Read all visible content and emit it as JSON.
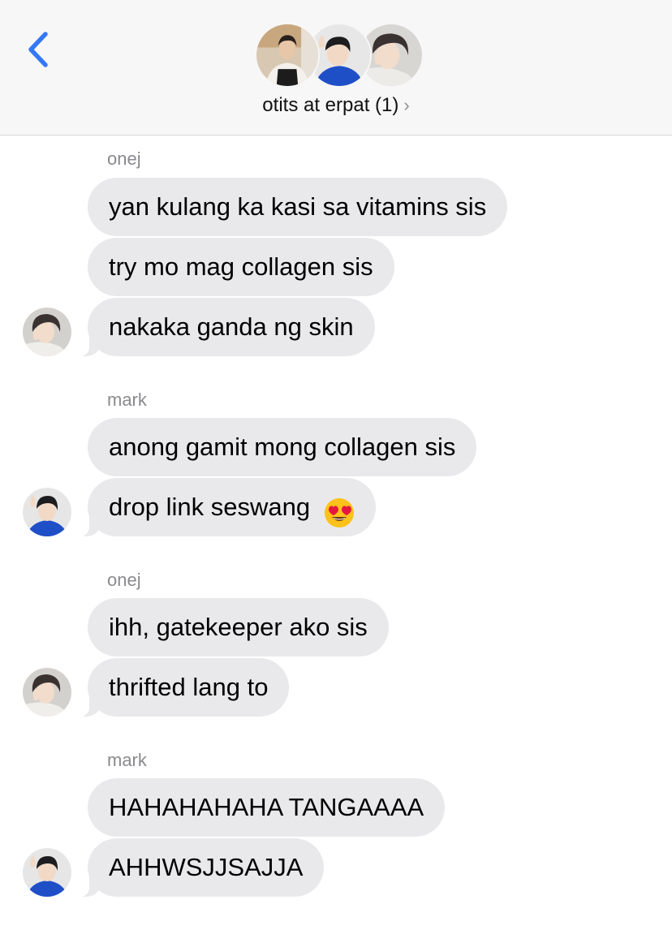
{
  "header": {
    "back_icon": "chevron-left-icon",
    "group_name": "otits at erpat (1)",
    "chevron": "›",
    "accent_color": "#3478f6"
  },
  "thread": {
    "bubble_color": "#e9e9eb",
    "groups": [
      {
        "sender": "onej",
        "messages": [
          "yan kulang ka kasi sa vitamins sis",
          "try mo mag collagen sis",
          "nakaka ganda ng skin"
        ]
      },
      {
        "sender": "mark",
        "messages": [
          "anong gamit mong collagen sis",
          "drop link seswang"
        ],
        "emoji": "heart-eyes-emoji"
      },
      {
        "sender": "onej",
        "messages": [
          "ihh, gatekeeper ako sis",
          "thrifted lang to"
        ]
      },
      {
        "sender": "mark",
        "messages": [
          "HAHAHAHAHA TANGAAAA",
          "AHHWSJJSAJJA"
        ]
      }
    ]
  }
}
